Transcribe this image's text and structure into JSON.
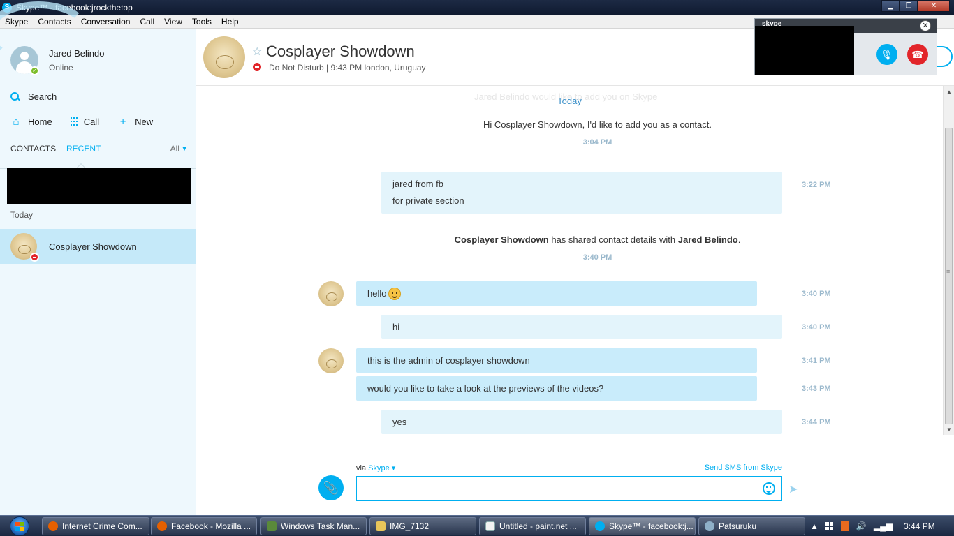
{
  "window": {
    "title": "Skype™ - facebook:jrockthetop",
    "app_icon": "S"
  },
  "menu": [
    "Skype",
    "Contacts",
    "Conversation",
    "Call",
    "View",
    "Tools",
    "Help"
  ],
  "profile": {
    "name": "Jared Belindo",
    "status": "Online"
  },
  "sidebar": {
    "search_label": "Search",
    "nav": {
      "home": "Home",
      "call": "Call",
      "new": "New"
    },
    "tabs": {
      "contacts": "CONTACTS",
      "recent": "RECENT",
      "all": "All"
    },
    "group_label": "Today",
    "recent_item_name": "Cosplayer Showdown"
  },
  "header": {
    "contact_name": "Cosplayer Showdown",
    "status_line": "Do Not Disturb | 9:43 PM london, Uruguay"
  },
  "call_overlay": {
    "logo": "skype"
  },
  "conversation": {
    "faded_top": "Jared Belindo would like to add you on Skype",
    "day_label": "Today",
    "request_text": "Hi Cosplayer Showdown, I'd like to add you as a contact.",
    "request_time": "3:04 PM",
    "msg1_line1": "jared from fb",
    "msg1_line2": "for private section",
    "msg1_time": "3:22 PM",
    "shared_from": "Cosplayer Showdown",
    "shared_middle": " has shared contact details with ",
    "shared_to": "Jared Belindo",
    "shared_end": ".",
    "shared_time": "3:40 PM",
    "msg2_text": "hello",
    "msg2_time": "3:40 PM",
    "msg3_text": "hi",
    "msg3_time": "3:40 PM",
    "msg4_text": "this is the admin of cosplayer showdown",
    "msg4_time": "3:41 PM",
    "msg5_text": "would you like to take a look at the previews of the videos?",
    "msg5_time": "3:43 PM",
    "msg6_text": "yes",
    "msg6_time": "3:44 PM"
  },
  "compose": {
    "via_prefix": "via ",
    "via_service": "Skype",
    "send_sms": "Send SMS from Skype",
    "input_value": ""
  },
  "taskbar": {
    "items": [
      "Internet Crime Com...",
      "Facebook - Mozilla ...",
      "Windows Task Man...",
      "IMG_7132",
      "Untitled - paint.net ...",
      "Skype™ - facebook:j...",
      "Patsuruku"
    ],
    "clock": "3:44 PM"
  },
  "colors": {
    "skype_blue": "#00aff0",
    "sidebar_bg": "#eef8fd",
    "dnd_red": "#e2252a",
    "online_green": "#7cbd2a"
  }
}
